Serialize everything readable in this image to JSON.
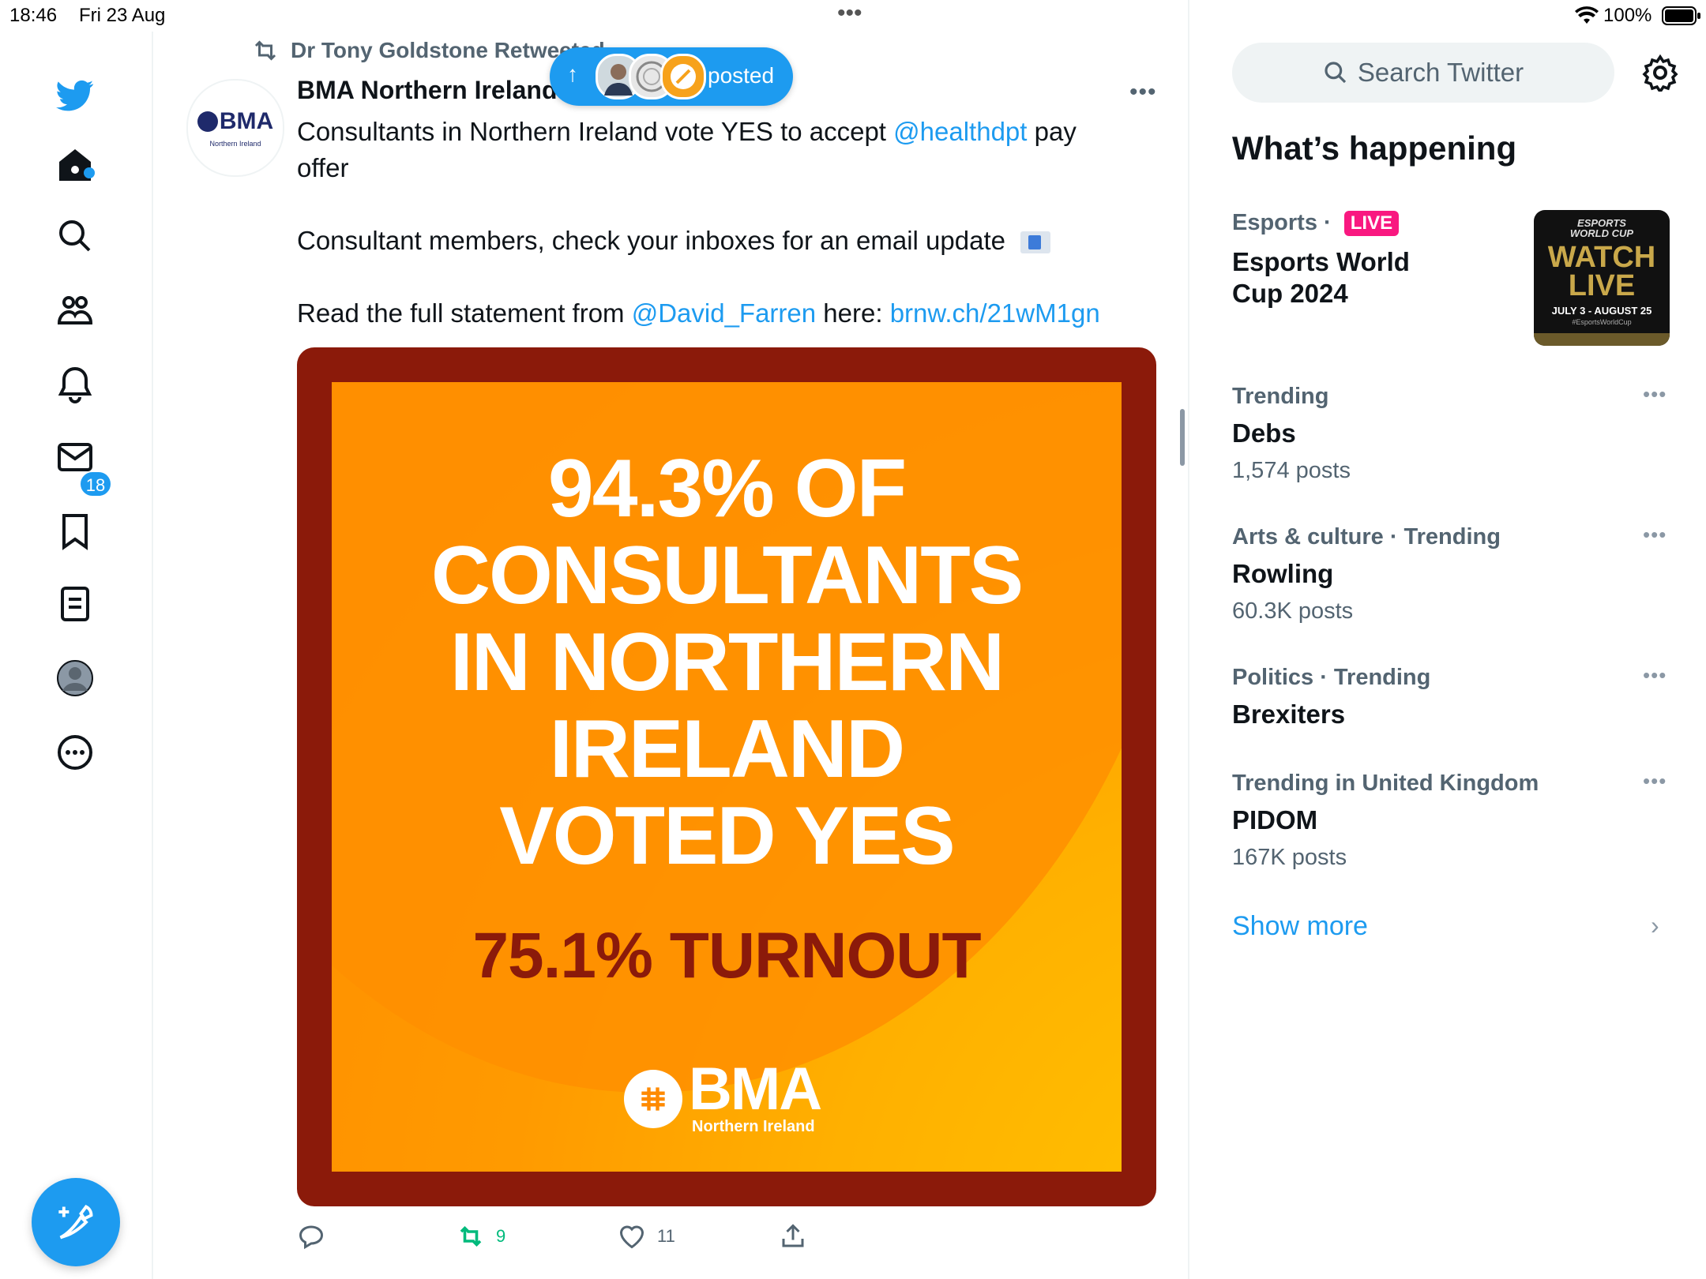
{
  "status_bar": {
    "time": "18:46",
    "date": "Fri 23 Aug",
    "battery": "100%",
    "multitask_dots": "•••"
  },
  "nav": {
    "notifications_badge": "18",
    "items": [
      "twitter-logo",
      "home-icon",
      "search-icon",
      "communities-icon",
      "notifications-icon",
      "messages-icon",
      "bookmarks-icon",
      "lists-icon",
      "profile-icon",
      "more-icon"
    ]
  },
  "tweet": {
    "retweet_context": "Dr Tony Goldstone Retweeted",
    "author_name": "BMA Northern Ireland",
    "avatar_text": "BMA",
    "avatar_subtext": "Northern Ireland",
    "more": "•••",
    "line1_pre": "Consultants in Northern Ireland vote YES to accept ",
    "line1_mention": "@healthdpt",
    "line1_post": " pay",
    "line2": "offer",
    "line3": "Consultant members, check your inboxes for an email update",
    "line4_pre": "Read the full statement from ",
    "line4_mention": "@David_Farren",
    "line4_mid": " here: ",
    "line4_link": "brnw.ch/21wM1gn",
    "media": {
      "headline_1": "94.3% OF",
      "headline_2": "CONSULTANTS",
      "headline_3": "IN NORTHERN",
      "headline_4": "IRELAND",
      "headline_5": "VOTED YES",
      "turnout": "75.1% TURNOUT",
      "logo_text": "BMA",
      "logo_subtext": "Northern Ireland"
    },
    "actions": {
      "reply_count": "",
      "retweet_count": "9",
      "like_count": "11"
    }
  },
  "posted_pill": {
    "label": "posted"
  },
  "sidebar": {
    "search_placeholder": "Search Twitter",
    "section_title": "What’s happening",
    "live_trend": {
      "category": "Esports · ",
      "live_label": "LIVE",
      "title_line1": "Esports World",
      "title_line2": "Cup 2024",
      "thumb_title_1": "ESPORTS",
      "thumb_title_2": "WORLD CUP",
      "thumb_watch": "WATCH",
      "thumb_live": "LIVE",
      "thumb_dates": "JULY 3 - AUGUST 25",
      "thumb_hashtag": "#EsportsWorldCup"
    },
    "trends": [
      {
        "meta": "Trending",
        "title": "Debs",
        "count": "1,574 posts"
      },
      {
        "meta": "Arts & culture · Trending",
        "title": "Rowling",
        "count": "60.3K posts"
      },
      {
        "meta": "Politics · Trending",
        "title": "Brexiters",
        "count": ""
      },
      {
        "meta": "Trending in United Kingdom",
        "title": "PIDOM",
        "count": "167K posts"
      }
    ],
    "trend_more": "•••",
    "show_more": "Show more",
    "show_more_chevron": "›"
  },
  "colors": {
    "accent": "#1d9bf0",
    "live": "#f91880",
    "media_frame": "#8b1a0a",
    "media_orange": "#ff8a00",
    "retweet_green": "#00ba7c"
  }
}
